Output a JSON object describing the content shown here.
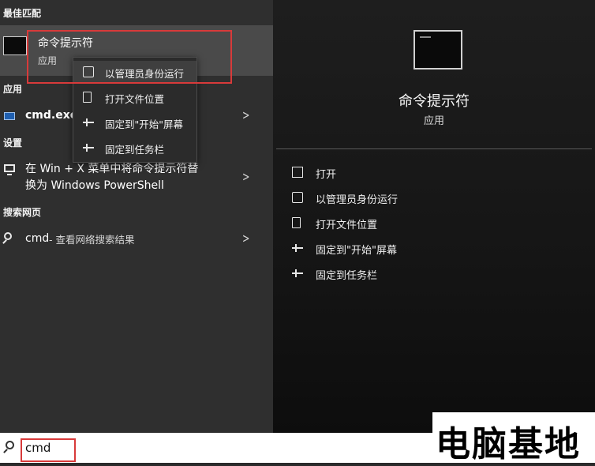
{
  "left": {
    "best_match_header": "最佳匹配",
    "best_match": {
      "title": "命令提示符",
      "subtitle": "应用"
    },
    "apps_header": "应用",
    "apps_item": "cmd.exe",
    "settings_header": "设置",
    "settings_item_line1": "在 Win + X 菜单中将命令提示符替",
    "settings_item_line2": "换为 Windows PowerShell",
    "web_header": "搜索网页",
    "web_item_query": "cmd",
    "web_item_suffix": " - 查看网络搜索结果"
  },
  "context_menu": {
    "items": [
      {
        "label": "以管理员身份运行",
        "icon": "shield-icon"
      },
      {
        "label": "打开文件位置",
        "icon": "file-icon"
      },
      {
        "label": "固定到\"开始\"屏幕",
        "icon": "pin-icon"
      },
      {
        "label": "固定到任务栏",
        "icon": "pin-icon"
      }
    ]
  },
  "right": {
    "title": "命令提示符",
    "subtitle": "应用",
    "actions": [
      {
        "label": "打开",
        "icon": "open-icon"
      },
      {
        "label": "以管理员身份运行",
        "icon": "shield-icon"
      },
      {
        "label": "打开文件位置",
        "icon": "file-icon"
      },
      {
        "label": "固定到\"开始\"屏幕",
        "icon": "pin-icon"
      },
      {
        "label": "固定到任务栏",
        "icon": "pin-icon"
      }
    ]
  },
  "taskbar": {
    "search_value": "cmd"
  },
  "watermark": {
    "text": "电脑基地"
  },
  "colors": {
    "highlight_red": "#d83a3a",
    "panel_left": "#2f2f2f",
    "panel_right": "#151515"
  }
}
